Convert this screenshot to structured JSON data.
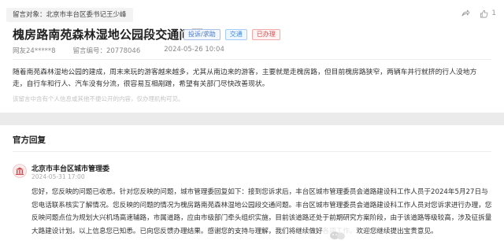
{
  "message": {
    "target_label": "留言对象：北京市丰台区委书记王少峰",
    "like_count": "1",
    "title": "槐房路南苑森林湿地公园段交通问题",
    "tags": {
      "type": "投诉/求助",
      "field": "交通",
      "status": "已办理"
    },
    "author": "网友24*****8",
    "message_id": "留言编号：20778046",
    "posted_at": "2024-05-26 10:04",
    "content": "随着南苑森林湿地公园的建成，周末来玩的游客越来越多，尤其从南边来的游客，主要就是走槐房路，但目前槐房路狭窄，两辆车并行就挤的行人没地方走，自行车和行人、汽车没有分流，很容易互相剐蹭，希望有关部门尽快改善现状。",
    "disclaimer": "该留言中含有个人信息或其他不便公开的内容，仅办理机构可见。"
  },
  "official_reply": {
    "section_title": "官方回复",
    "org_name": "北京市丰台区城市管理委",
    "reply_time": "2024-05-31 17:00",
    "text": "您好，您反映的问题已收悉。针对您反映的问题，城市管理委回复如下：接到您诉求后，丰台区城市管理委员会道路建设科工作人员于2024年5月27日与您电话联系核实了解情况。您反映的问题的情况为槐房路南苑森林湿地公园段交通问题。丰台区城市管理委员会道路建设科工作人员对您诉求进行办理，您反映问题点位为规划大兴机场高速辅路，市属道路，应由市级部门牵头组织实施，目前该道路还处于前期研究方案阶段，由于该道路等级较高，涉及征拆量大路建设计划。以上信息您已知悉。已向您反馈办理结果。感谢您的支持与理解，我们将继续做好各项工作。欢迎您继续提出宝贵意见。"
  },
  "colors": {
    "background": "#ebebeb",
    "card": "#ffffff",
    "status_red": "#e04848",
    "tag_blue": "#3a8ae0",
    "muted_text": "#999999"
  },
  "icons": {
    "share": "share-icon",
    "like": "thumbs-up-icon",
    "avatar": "government-building-icon"
  }
}
